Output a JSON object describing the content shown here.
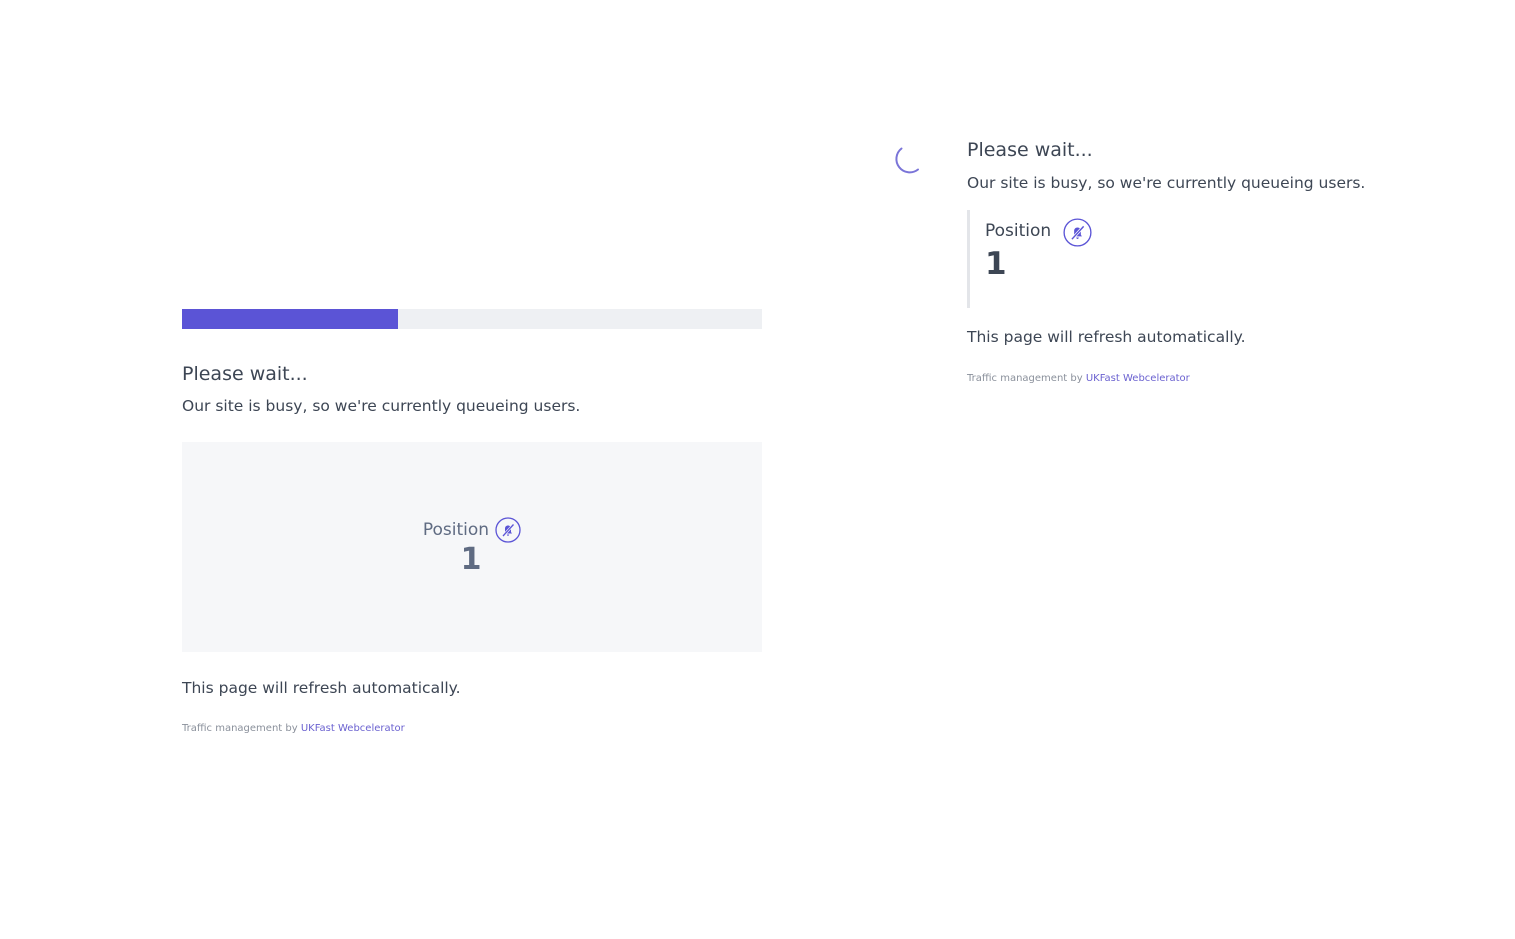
{
  "accent_color": "#5b54d6",
  "queue_progress": 0.372,
  "left_panel": {
    "heading": "Please wait...",
    "subtext": "Our site is busy, so we're currently queueing users.",
    "position_label": "Position",
    "position_value": "1",
    "refresh_text": "This page will refresh automatically.",
    "footer_prefix": "Traffic management by",
    "footer_link": "UKFast Webcelerator",
    "notification_icon": "bell-off-icon"
  },
  "right_panel": {
    "heading": "Please wait...",
    "subtext": "Our site is busy, so we're currently queueing users.",
    "position_label": "Position",
    "position_value": "1",
    "refresh_text": "This page will refresh automatically.",
    "footer_prefix": "Traffic management by",
    "footer_link": "UKFast Webcelerator",
    "notification_icon": "bell-off-icon",
    "loading_icon": "spinner-icon"
  }
}
